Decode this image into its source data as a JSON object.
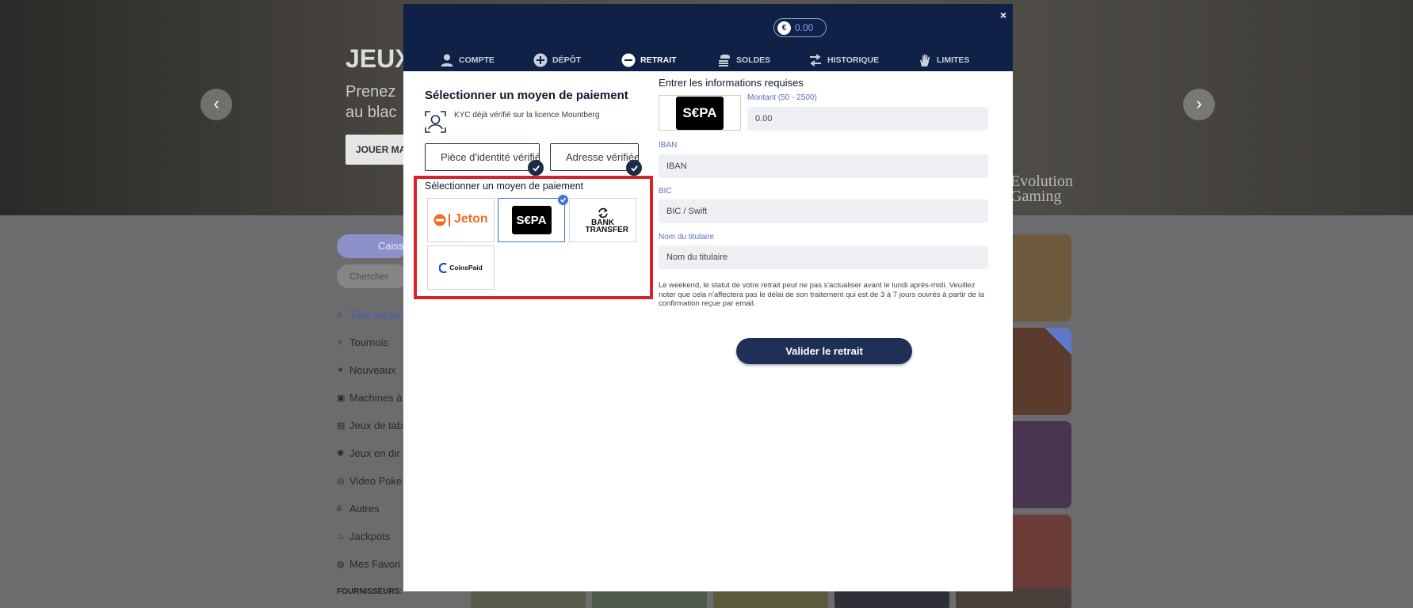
{
  "background": {
    "hero_title": "JEUX",
    "hero_subtitle": "Prenez\nau blac",
    "hero_button": "JOUER MA",
    "evolution_logo": "Evolution\nGaming",
    "cashier_pill": "Caiss",
    "search_placeholder": "Chercher",
    "nav_items": [
      {
        "label": "Tous les jeu",
        "icon": "home-icon"
      },
      {
        "label": "Tournois",
        "icon": "trophy-icon"
      },
      {
        "label": "Nouveaux",
        "icon": "new-icon"
      },
      {
        "label": "Machines à",
        "icon": "slot-icon"
      },
      {
        "label": "Jeux de tab",
        "icon": "cards-icon"
      },
      {
        "label": "Jeux en dir",
        "icon": "live-icon"
      },
      {
        "label": "Video Poke",
        "icon": "poker-icon"
      },
      {
        "label": "Autres",
        "icon": "hash-icon"
      },
      {
        "label": "Jackpots",
        "icon": "fire-icon"
      },
      {
        "label": "Mes Favori",
        "icon": "heart-icon"
      }
    ],
    "providers_label": "FOURNISSEURS:"
  },
  "modal": {
    "close": "×",
    "balance": {
      "currency_symbol": "€",
      "value": "0.00"
    },
    "tabs": [
      {
        "label": "COMPTE",
        "icon": "user-icon",
        "active": false
      },
      {
        "label": "DÉPÔT",
        "icon": "plus-circle-icon",
        "active": false
      },
      {
        "label": "RETRAIT",
        "icon": "minus-circle-icon",
        "active": true
      },
      {
        "label": "SOLDES",
        "icon": "coins-icon",
        "active": false
      },
      {
        "label": "HISTORIQUE",
        "icon": "arrows-icon",
        "active": false
      },
      {
        "label": "LIMITES",
        "icon": "hand-icon",
        "active": false
      }
    ],
    "left": {
      "title": "Sélectionner un moyen de paiement",
      "kyc_text": "KYC déjà vérifié sur la licence Mountberg",
      "id_verified": "Pièce d'identité vérifiée",
      "address_verified": "Adresse vérifiée",
      "payment_label": "Sélectionner un moyen de paiement",
      "methods": [
        {
          "name": "Jeton",
          "selected": false
        },
        {
          "name": "S€PA",
          "selected": true
        },
        {
          "name": "BANK TRANSFER",
          "selected": false
        },
        {
          "name": "CoinsPaid",
          "selected": false
        }
      ]
    },
    "right": {
      "title": "Entrer les informations requises",
      "amount_label": "Montant (50 - 2500)",
      "amount_placeholder": "0.00",
      "iban_label": "IBAN",
      "iban_placeholder": "IBAN",
      "bic_label": "BIC",
      "bic_placeholder": "BIC / Swift",
      "holder_label": "Nom du titulaire",
      "holder_placeholder": "Nom du titulaire",
      "notice": "Le weekend, le statut de votre retrait peut ne pas s'actualiser avant le lundi après-midi. Veuillez noter que cela n'affectera pas le délai de son traitement qui est de 3 à 7 jours ouvrés à partir de la confirmation reçue par email.",
      "submit": "Valider le retrait"
    }
  },
  "colors": {
    "header_navy": "#0f2146",
    "highlight_red": "#d6222b",
    "label_blue": "#5a6fb6",
    "select_blue": "#3f77d6",
    "jeton_orange": "#f26a21"
  }
}
